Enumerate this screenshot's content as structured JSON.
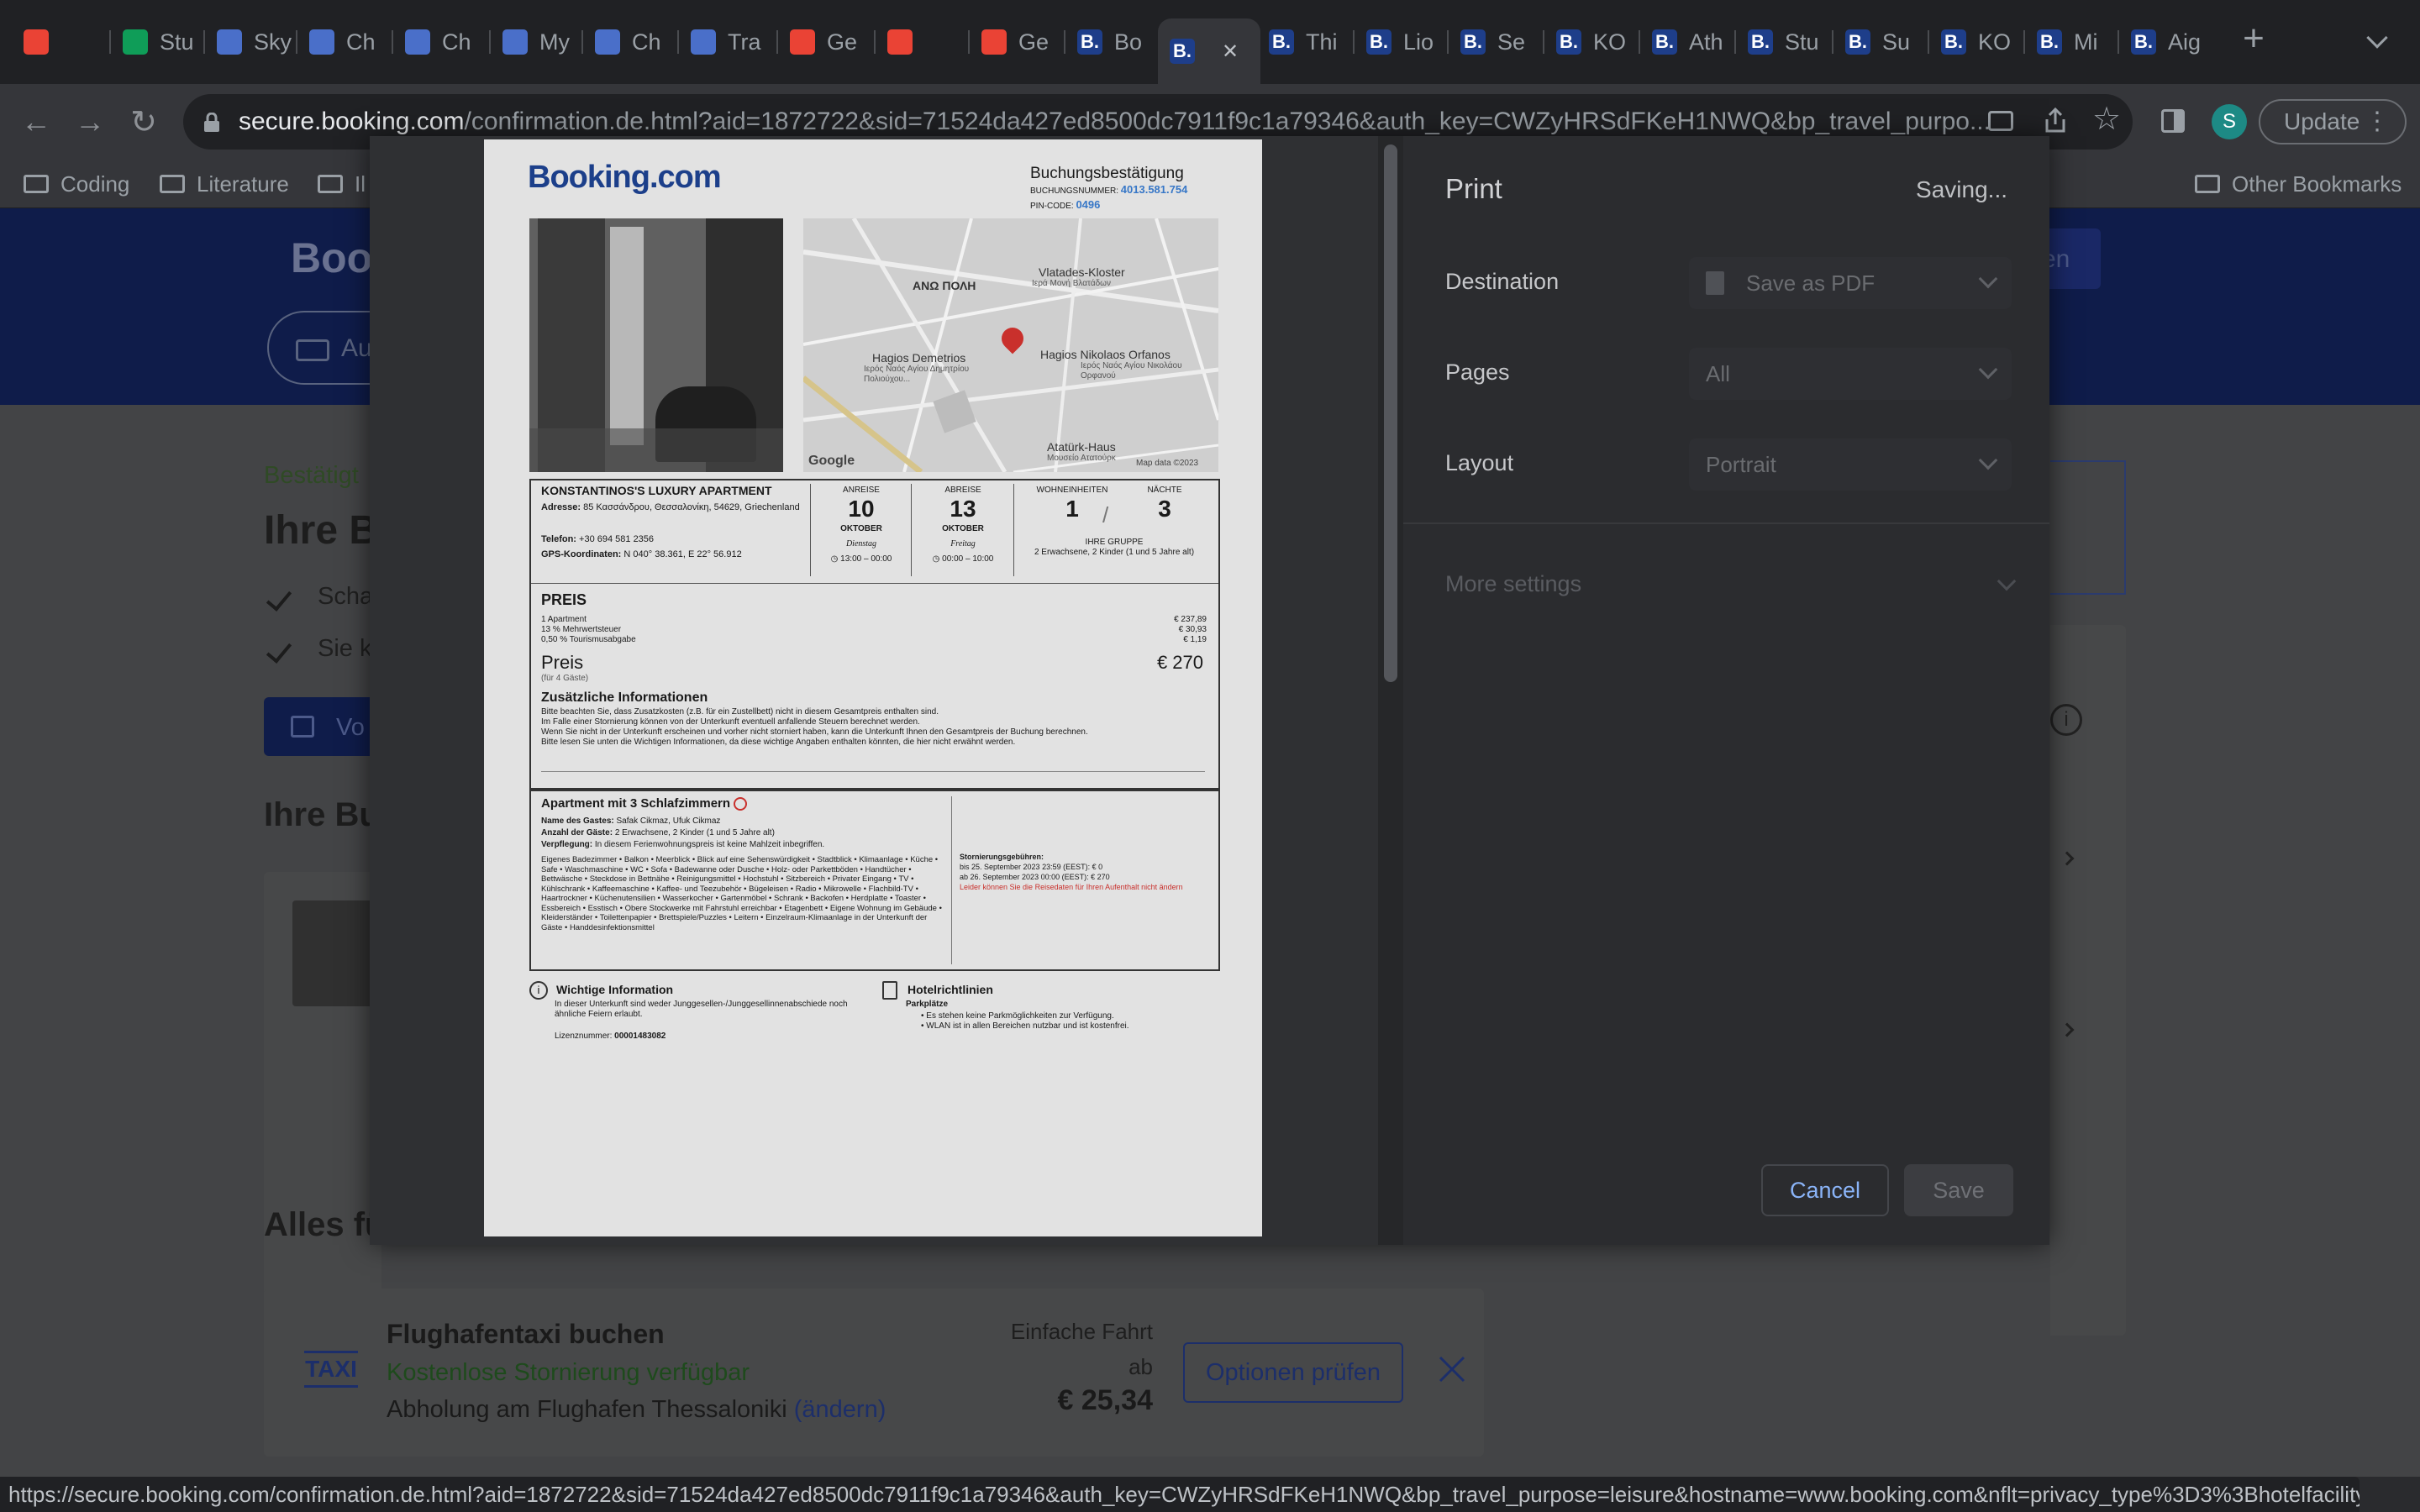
{
  "tabs": [
    {
      "label": "",
      "icon": "gmail-icon"
    },
    {
      "label": "Stu",
      "icon": "sheets-icon"
    },
    {
      "label": "Sky",
      "icon": "site-icon"
    },
    {
      "label": "Ch",
      "icon": "site-icon"
    },
    {
      "label": "Ch",
      "icon": "site-icon"
    },
    {
      "label": "My",
      "icon": "site-icon"
    },
    {
      "label": "Ch",
      "icon": "site-icon"
    },
    {
      "label": "Tra",
      "icon": "site-icon"
    },
    {
      "label": "Ge",
      "icon": "gmail-icon"
    },
    {
      "label": "",
      "icon": "gmail-icon"
    },
    {
      "label": "Ge",
      "icon": "gmail-icon"
    },
    {
      "label": "Bo",
      "icon": "booking-icon"
    },
    {
      "label": "",
      "icon": "booking-icon"
    },
    {
      "label": "Thi",
      "icon": "booking-icon"
    },
    {
      "label": "Lio",
      "icon": "booking-icon"
    },
    {
      "label": "Se",
      "icon": "booking-icon"
    },
    {
      "label": "KO",
      "icon": "booking-icon"
    },
    {
      "label": "Ath",
      "icon": "booking-icon"
    },
    {
      "label": "Stu",
      "icon": "booking-icon"
    },
    {
      "label": "Su",
      "icon": "booking-icon"
    },
    {
      "label": "KO",
      "icon": "booking-icon"
    },
    {
      "label": "Mi",
      "icon": "booking-icon"
    },
    {
      "label": "Aig",
      "icon": "booking-icon"
    }
  ],
  "address": {
    "host": "secure.booking.com",
    "path": "/confirmation.de.html?aid=1872722&sid=71524da427ed8500dc7911f9c1a79346&auth_key=CWZyHRSdFKeH1NWQ&bp_travel_purpo..."
  },
  "toolbar": {
    "update_label": "Update",
    "profile_initial": "S"
  },
  "bookmarks": [
    {
      "label": "Coding"
    },
    {
      "label": "Literature"
    },
    {
      "label": "Il"
    }
  ],
  "other_bookmarks": "Other Bookmarks",
  "page": {
    "brand_partial": "Book",
    "search_partial": "Au",
    "confirmed_partial": "Bestätigt",
    "heading_partial": "Ihre B",
    "check1_partial": "Scha",
    "check2_partial": "Sie k",
    "print_btn_partial": "Vo",
    "your_booking_partial": "Ihre Bu",
    "all_for_partial": "Alles fü",
    "right_btn_partial": "en",
    "taxi": {
      "logo": "TAXI",
      "title": "Flughafentaxi buchen",
      "free_cancel": "Kostenlose Stornierung verfügbar",
      "pickup": "Abholung am Flughafen Thessaloniki",
      "change": "(ändern)",
      "oneway": "Einfache Fahrt",
      "from": "ab",
      "price": "€ 25,34",
      "options_btn": "Optionen prüfen"
    }
  },
  "print": {
    "title": "Print",
    "status": "Saving...",
    "destination_label": "Destination",
    "destination_value": "Save as PDF",
    "pages_label": "Pages",
    "pages_value": "All",
    "layout_label": "Layout",
    "layout_value": "Portrait",
    "more_settings": "More settings",
    "cancel": "Cancel",
    "save": "Save"
  },
  "confirmation": {
    "logo": "Booking.com",
    "title": "Buchungsbestätigung",
    "booking_number_label": "BUCHUNGSNUMMER:",
    "booking_number": "4013.581.754",
    "pin_label": "PIN-CODE:",
    "pin": "0496",
    "map_labels": {
      "area": "ΑΝΩ ΠΟΛΗ",
      "vlatades": "Vlatades-Kloster",
      "vlatades_gr": "Ιερά Μονή Βλατάδων",
      "demetrios": "Hagios Demetrios",
      "demetrios_gr": "Ιερός Ναός Αγίου Δημητρίου Πολιούχου...",
      "nikolaos": "Hagios Nikolaos Orfanos",
      "nikolaos_gr": "Ιερός Ναός Αγίου Νικολάου Ορφανού",
      "ataturk": "Atatürk-Haus",
      "ataturk_gr": "Μουσείο Ατατούρκ",
      "google": "Google",
      "map_data": "Map data ©2023"
    },
    "property_name": "KONSTANTINOS'S LUXURY APARTMENT",
    "address_label": "Adresse:",
    "address": "85 Κασσάνδρου, Θεσσαλονίκη, 54629, Griechenland",
    "phone_label": "Telefon:",
    "phone": "+30 694 581 2356",
    "gps_label": "GPS-Koordinaten:",
    "gps": "N 040° 38.361, E 22° 56.912",
    "checkin_label": "ANREISE",
    "checkin_day": "10",
    "checkin_month": "OKTOBER",
    "checkin_weekday": "Dienstag",
    "checkin_time": "13:00 – 00:00",
    "checkout_label": "ABREISE",
    "checkout_day": "13",
    "checkout_month": "OKTOBER",
    "checkout_weekday": "Freitag",
    "checkout_time": "00:00 – 10:00",
    "units_label": "WOHNEINHEITEN",
    "units": "1",
    "nights_label": "NÄCHTE",
    "nights": "3",
    "group_label": "IHRE GRUPPE",
    "group": "2 Erwachsene, 2 Kinder (1 und 5 Jahre alt)",
    "price_heading": "PREIS",
    "price_rows": [
      {
        "label": "1 Apartment",
        "value": "€ 237,89"
      },
      {
        "label": "13 % Mehrwertsteuer",
        "value": "€ 30,93"
      },
      {
        "label": "0,50 % Tourismusabgabe",
        "value": "€ 1,19"
      }
    ],
    "price_total_label": "Preis",
    "price_total": "€ 270",
    "price_guests": "(für 4 Gäste)",
    "extra_heading": "Zusätzliche Informationen",
    "extra_lines": [
      "Bitte beachten Sie, dass Zusatzkosten (z.B. für ein Zustellbett) nicht in diesem Gesamtpreis enthalten sind.",
      "Im Falle einer Stornierung können von der Unterkunft eventuell anfallende Steuern berechnet werden.",
      "Wenn Sie nicht in der Unterkunft erscheinen und vorher nicht storniert haben, kann die Unterkunft Ihnen den Gesamtpreis der Buchung berechnen.",
      "Bitte lesen Sie unten die Wichtigen Informationen, da diese wichtige Angaben enthalten könnten, die hier nicht erwähnt werden."
    ],
    "room_heading": "Apartment mit 3 Schlafzimmern",
    "guest_name_label": "Name des Gastes:",
    "guest_name": "Safak Cikmaz, Ufuk Cikmaz",
    "guest_count_label": "Anzahl der Gäste:",
    "guest_count": "2 Erwachsene, 2 Kinder (1 und 5 Jahre alt)",
    "meal_label": "Verpflegung:",
    "meal": "In diesem Ferienwohnungspreis ist keine Mahlzeit inbegriffen.",
    "amenities": "Eigenes Badezimmer • Balkon • Meerblick • Blick auf eine Sehenswürdigkeit • Stadtblick • Klimaanlage • Küche • Safe • Waschmaschine • WC • Sofa • Badewanne oder Dusche • Holz- oder Parkettböden • Handtücher • Bettwäsche • Steckdose in Bettnähe • Reinigungsmittel • Hochstuhl • Sitzbereich • Privater Eingang • TV • Kühlschrank • Kaffeemaschine • Kaffee- und Teezubehör • Bügeleisen • Radio • Mikrowelle • Flachbild-TV • Haartrockner • Küchenutensilien • Wasserkocher • Gartenmöbel • Schrank • Backofen • Herdplatte • Toaster • Essbereich • Esstisch • Obere Stockwerke mit Fahrstuhl erreichbar • Etagenbett • Eigene Wohnung im Gebäude • Kleiderständer • Toilettenpapier • Brettspiele/Puzzles • Leitern • Einzelraum-Klimaanlage in der Unterkunft der Gäste • Handdesinfektionsmittel",
    "cancel_heading": "Stornierungsgebühren:",
    "cancel_line1": "bis 25. September 2023 23:59 (EEST): € 0",
    "cancel_line2": "ab 26. September 2023 00:00 (EEST): € 270",
    "cancel_note": "Leider können Sie die Reisedaten für Ihren Aufenthalt nicht ändern",
    "important_heading": "Wichtige Information",
    "important_text": "In dieser Unterkunft sind weder Junggesellen-/Junggesellinnenabschiede noch ähnliche Feiern erlaubt.",
    "license_label": "Lizenznummer:",
    "license": "00001483082",
    "hotel_heading": "Hotelrichtlinien",
    "parking_label": "Parkplätze",
    "hotel_rules": [
      "Es stehen keine Parkmöglichkeiten zur Verfügung.",
      "WLAN ist in allen Bereichen nutzbar und ist kostenfrei."
    ]
  },
  "status_url": "https://secure.booking.com/confirmation.de.html?aid=1872722&sid=71524da427ed8500dc7911f9c1a79346&auth_key=CWZyHRSdFKeH1NWQ&bp_travel_purpose=leisure&hostname=www.booking.com&nflt=privacy_type%3D3%3Bhotelfacility..."
}
